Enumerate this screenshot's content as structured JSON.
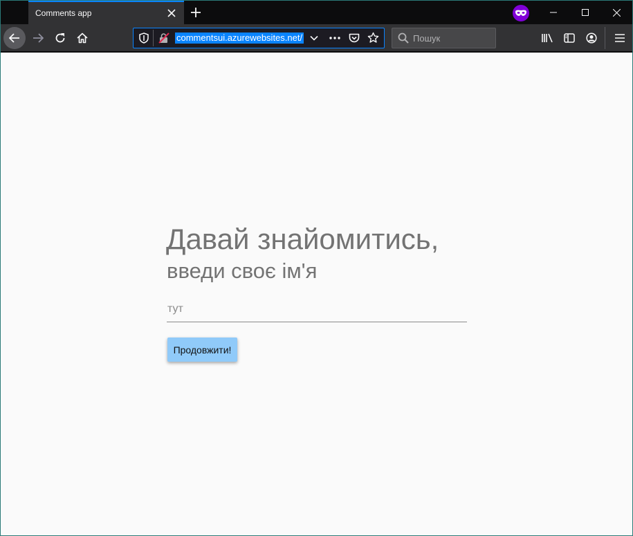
{
  "browser": {
    "tab_title": "Comments app",
    "url": "commentsui.azurewebsites.net/",
    "search_placeholder": "Пошук",
    "accent_color": "#0a84ff",
    "private_badge_color": "#8000d7"
  },
  "icons": {
    "tab_close": "close-icon",
    "new_tab": "plus-icon",
    "private": "private-browsing-mask-icon",
    "back": "arrow-left-icon",
    "forward": "arrow-right-icon",
    "reload": "reload-icon",
    "home": "home-icon",
    "tracking": "shield-icon",
    "insecure": "insecure-lock-icon",
    "dropdown": "chevron-down-icon",
    "page_actions": "more-dots-icon",
    "pocket": "pocket-icon",
    "bookmark": "star-icon",
    "search": "search-icon",
    "library": "library-icon",
    "sidebar": "sidebar-icon",
    "account": "account-icon",
    "menu": "hamburger-menu-icon",
    "minimize": "minimize-icon",
    "maximize": "maximize-icon",
    "close_window": "close-window-icon"
  },
  "page": {
    "heading_line1": "Давай знайомитись,",
    "heading_line2": "введи своє ім'я",
    "name_placeholder": "тут",
    "name_value": "",
    "continue_label": "Продовжити!",
    "button_color": "#90caf9"
  }
}
